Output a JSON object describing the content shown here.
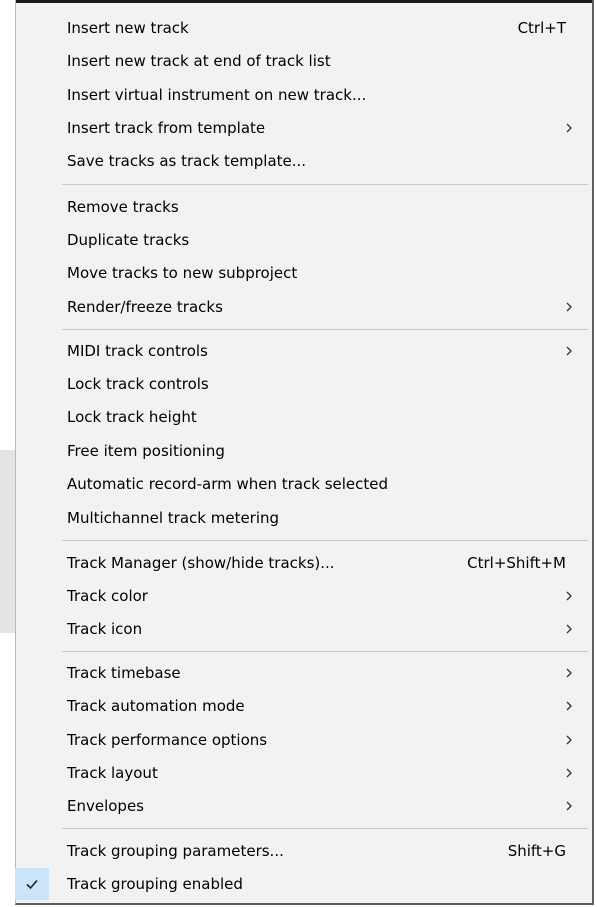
{
  "menu": {
    "items": [
      {
        "label": "Insert new track",
        "shortcut": "Ctrl+T"
      },
      {
        "label": "Insert new track at end of track list"
      },
      {
        "label": "Insert virtual instrument on new track..."
      },
      {
        "label": "Insert track from template",
        "icon": "chevron-right-icon"
      },
      {
        "label": "Save tracks as track template..."
      },
      {
        "label": "Remove tracks"
      },
      {
        "label": "Duplicate tracks"
      },
      {
        "label": "Move tracks to new subproject"
      },
      {
        "label": "Render/freeze tracks",
        "icon": "chevron-right-icon"
      },
      {
        "label": "MIDI track controls",
        "icon": "chevron-right-icon"
      },
      {
        "label": "Lock track controls"
      },
      {
        "label": "Lock track height"
      },
      {
        "label": "Free item positioning"
      },
      {
        "label": "Automatic record-arm when track selected"
      },
      {
        "label": "Multichannel track metering"
      },
      {
        "label": "Track Manager (show/hide tracks)...",
        "shortcut": "Ctrl+Shift+M"
      },
      {
        "label": "Track color",
        "icon": "chevron-right-icon"
      },
      {
        "label": "Track icon",
        "icon": "chevron-right-icon"
      },
      {
        "label": "Track timebase",
        "icon": "chevron-right-icon"
      },
      {
        "label": "Track automation mode",
        "icon": "chevron-right-icon"
      },
      {
        "label": "Track performance options",
        "icon": "chevron-right-icon"
      },
      {
        "label": "Track layout",
        "icon": "chevron-right-icon"
      },
      {
        "label": "Envelopes",
        "icon": "chevron-right-icon"
      },
      {
        "label": "Track grouping parameters...",
        "shortcut": "Shift+G"
      },
      {
        "label": "Track grouping enabled",
        "checked": true,
        "icon": "checkmark-icon"
      }
    ]
  },
  "colors": {
    "menu_background": "#f2f2f2",
    "checked_gutter": "#cce4f7",
    "separator": "#c8c8c8"
  }
}
